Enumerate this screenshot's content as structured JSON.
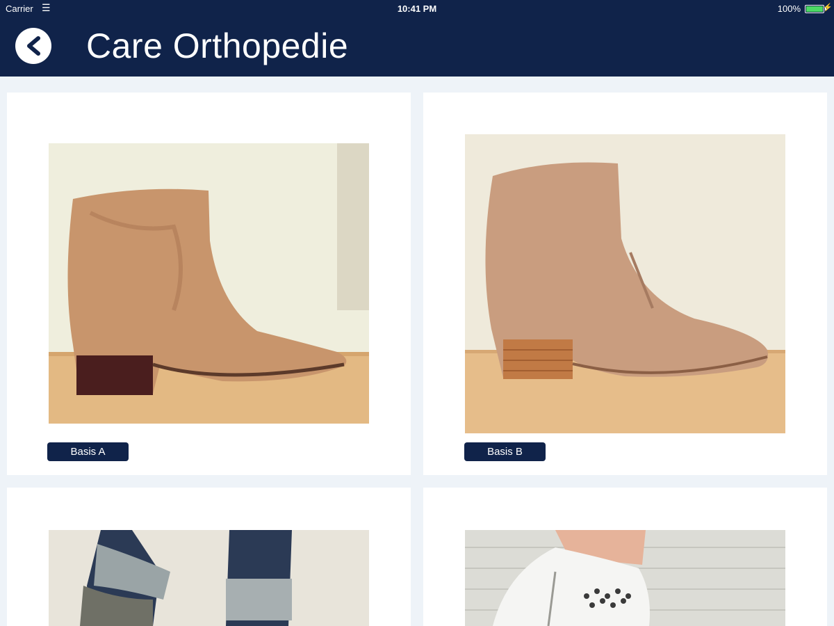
{
  "status_bar": {
    "carrier": "Carrier",
    "time": "10:41 PM",
    "battery": "100%"
  },
  "header": {
    "title": "Care Orthopedie",
    "back_icon": "chevron-left-icon"
  },
  "products": [
    {
      "label": "Basis A"
    },
    {
      "label": "Basis B"
    },
    {
      "label": ""
    },
    {
      "label": ""
    }
  ],
  "colors": {
    "nav_bg": "#10234a",
    "page_bg": "#eef3f8",
    "card_bg": "#ffffff",
    "tag_bg": "#10234a"
  }
}
